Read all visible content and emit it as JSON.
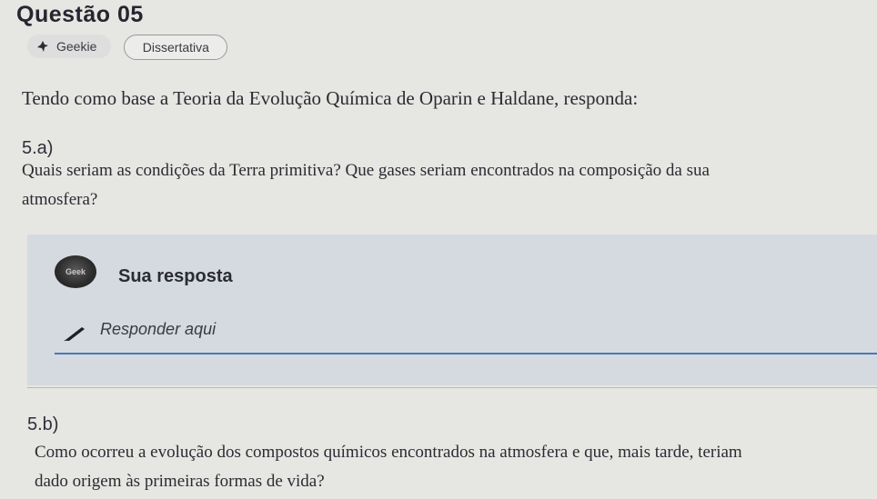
{
  "question": {
    "title": "Questão 05",
    "tags": {
      "source": "Geekie",
      "source_icon": "bird-icon",
      "type": "Dissertativa"
    },
    "prompt": "Tendo como base a Teoria da Evolução Química de Oparin e Haldane, responda:"
  },
  "part_a": {
    "label": "5.a)",
    "line1": "Quais seriam as condições da Terra primitiva? Que gases seriam encontrados na composição da sua",
    "line2": "atmosfera?"
  },
  "answer": {
    "avatar_text": "Geek",
    "title": "Sua resposta",
    "placeholder": "Responder aqui",
    "accent_color": "#4a78b5",
    "panel_color": "#d5dae0"
  },
  "part_b": {
    "label": "5.b)",
    "line1": "Como ocorreu a evolução dos compostos químicos encontrados na atmosfera e que, mais tarde, teriam",
    "line2": "dado origem às primeiras formas de vida?"
  }
}
